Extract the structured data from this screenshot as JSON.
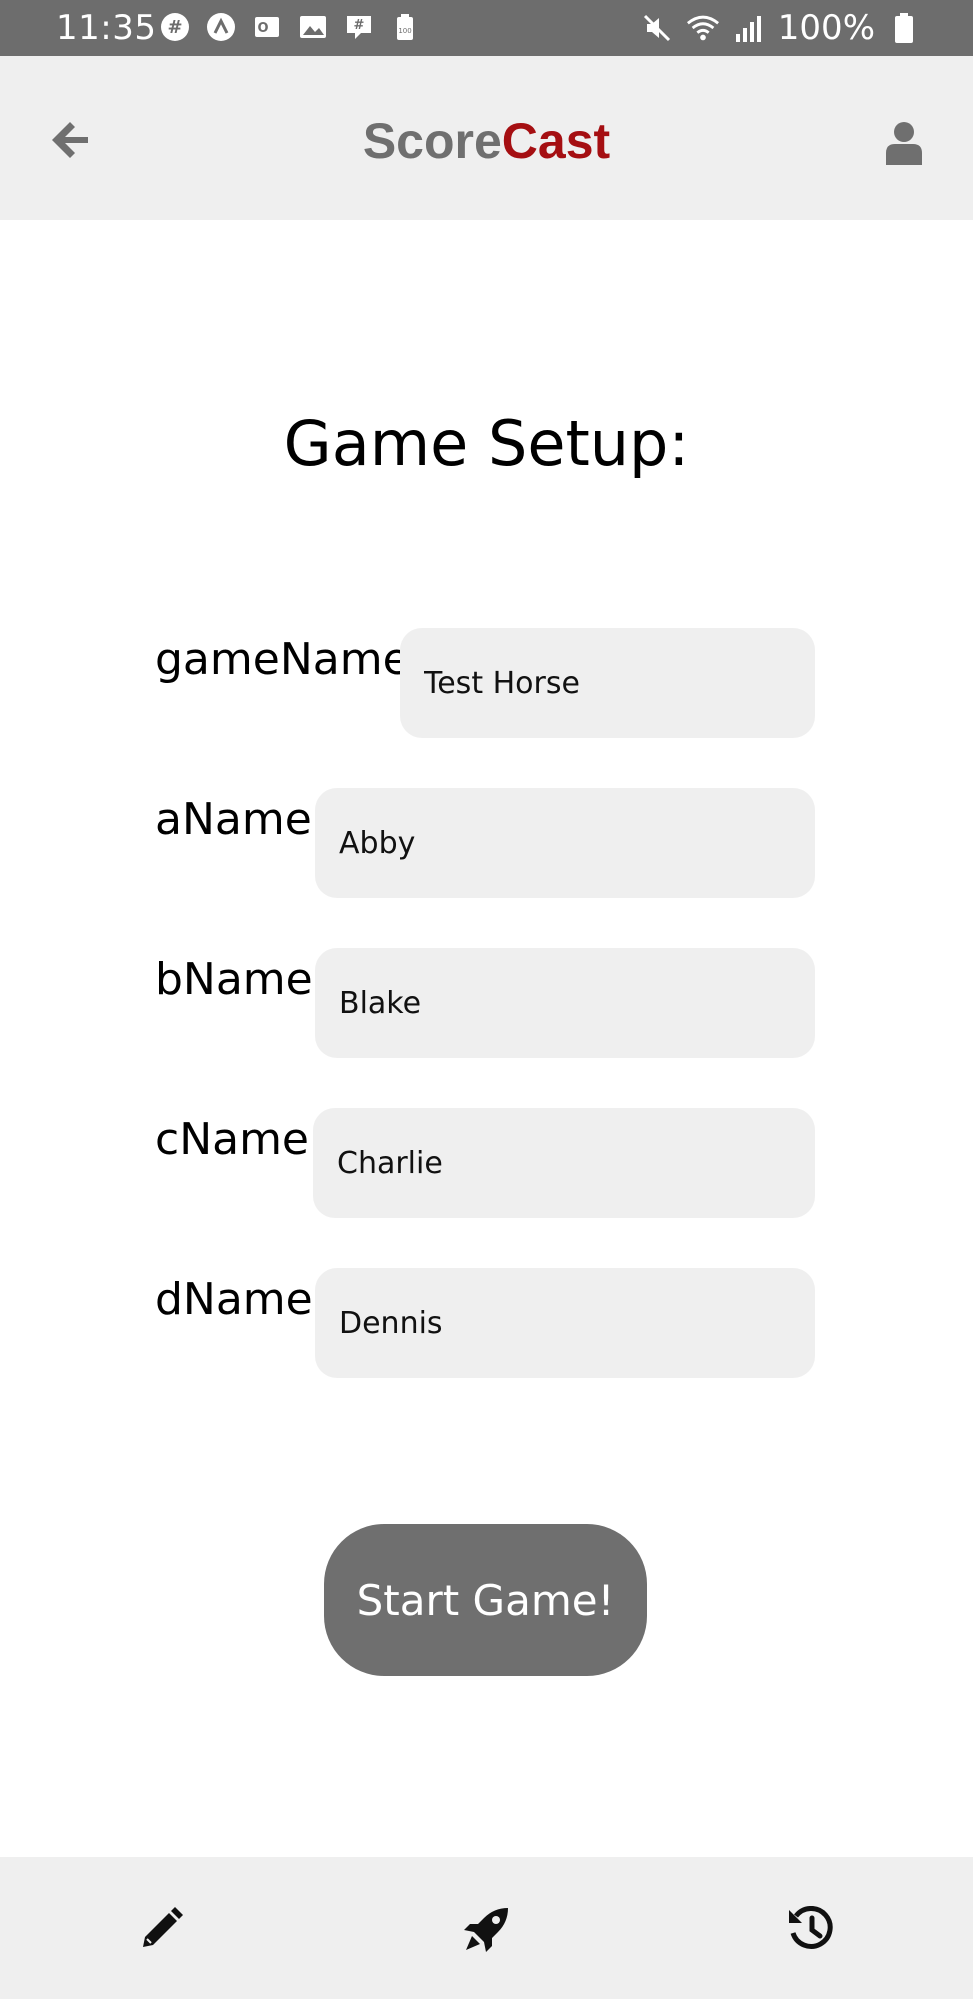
{
  "status_bar": {
    "time": "11:35",
    "battery": "100%",
    "left_icons": [
      "slack-icon",
      "app-icon",
      "outlook-icon",
      "gallery-icon",
      "chat-icon",
      "battery-saver-icon"
    ],
    "right_icons": [
      "mute-icon",
      "wifi-icon",
      "signal-icon",
      "battery-icon"
    ]
  },
  "header": {
    "title_part1": "Score",
    "title_part2": "Cast",
    "title_colors": {
      "part1": "#6f6f6f",
      "part2": "#a50f12"
    },
    "back_icon": "arrow-left-icon",
    "profile_icon": "user-icon"
  },
  "main": {
    "title": "Game Setup:",
    "fields": {
      "game_name": {
        "label": "gameName:",
        "value": "Test Horse"
      },
      "a_name": {
        "label": "aName:",
        "value": "Abby"
      },
      "b_name": {
        "label": "bName:",
        "value": "Blake"
      },
      "c_name": {
        "label": "cName:",
        "value": "Charlie"
      },
      "d_name": {
        "label": "dName:",
        "value": "Dennis"
      }
    },
    "start_button": "Start Game!"
  },
  "bottom_nav": {
    "items": [
      "pencil-icon",
      "rocket-icon",
      "history-icon"
    ]
  },
  "colors": {
    "status_bar": "#6d6d6d",
    "header_bg": "#efefef",
    "button_bg": "#6f6f6f",
    "brand_red": "#a50f12"
  }
}
